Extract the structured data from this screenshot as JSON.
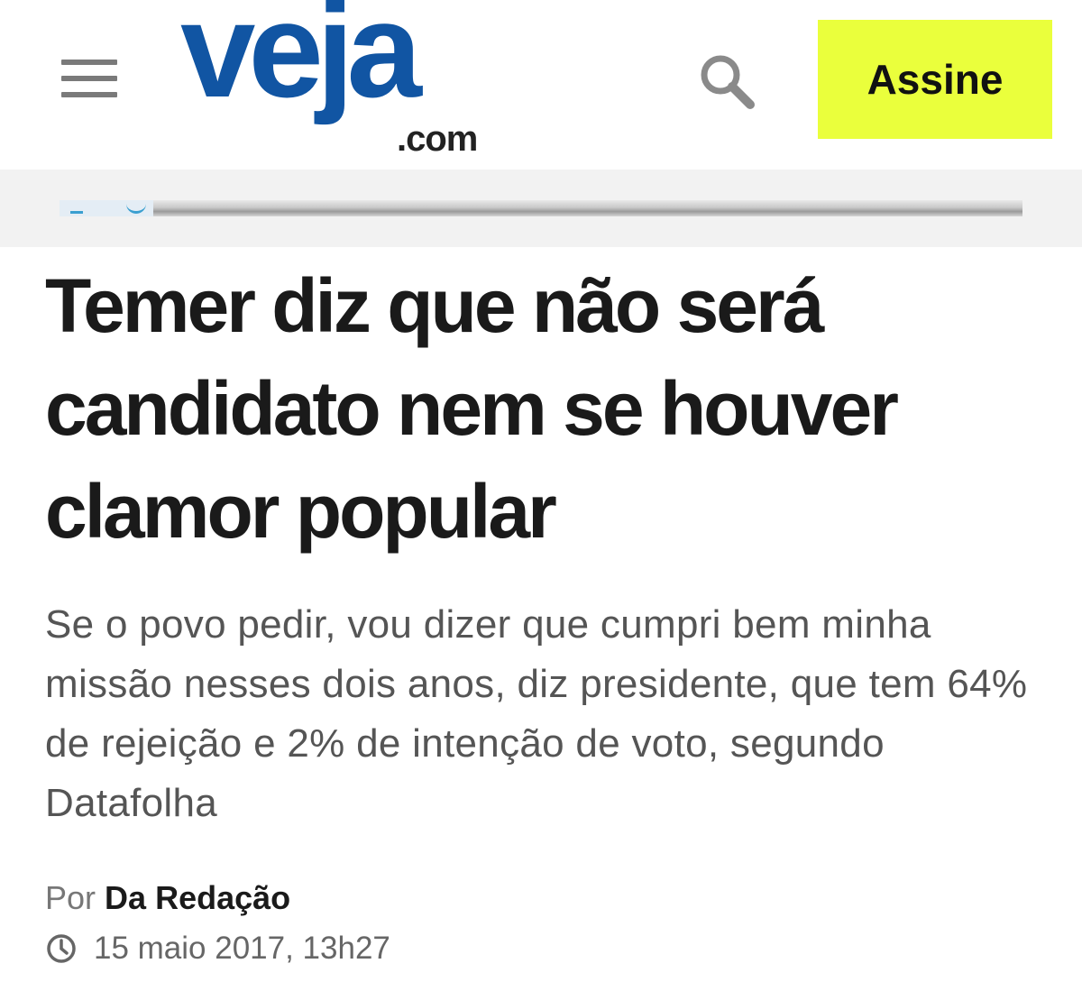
{
  "header": {
    "menu_icon": "hamburger-menu-icon",
    "logo": {
      "main": "veja",
      "suffix": ".com"
    },
    "search_icon": "search-icon",
    "subscribe_label": "Assine",
    "subscribe_color": "#eaff3c",
    "brand_color": "#1155a3"
  },
  "article": {
    "headline": "Temer diz que não será candidato nem se houver clamor popular",
    "subtitle": "Se o povo pedir, vou dizer que cumpri bem minha missão nesses dois anos, diz presidente, que tem 64% de rejeição e 2% de intenção de voto, segundo Datafolha",
    "byline_prefix": "Por",
    "author": "Da Redação",
    "clock_icon": "clock-icon",
    "date": "15 maio 2017, 13h27"
  }
}
